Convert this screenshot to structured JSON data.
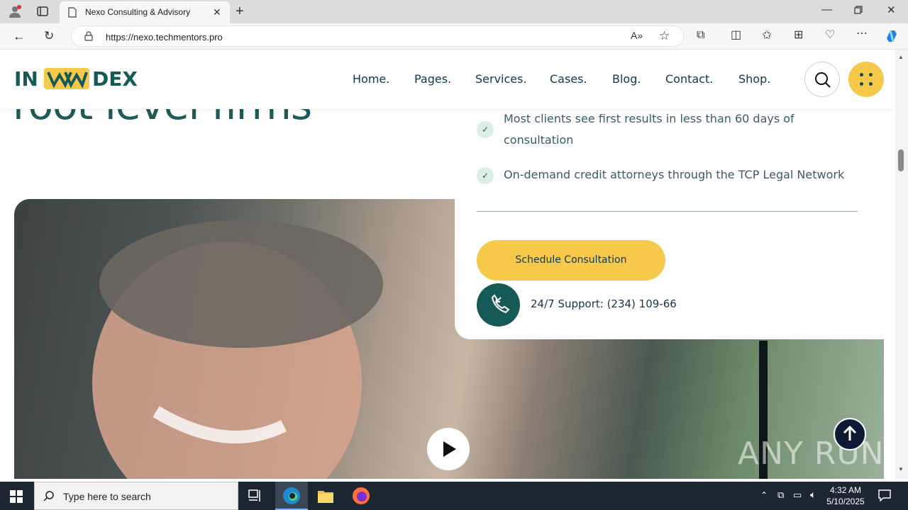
{
  "browser": {
    "tab_title": "Nexo Consulting & Advisory",
    "url": "https://nexo.techmentors.pro"
  },
  "site": {
    "logo_left": "IN",
    "logo_right": "DEX",
    "nav": [
      "Home.",
      "Pages.",
      "Services.",
      "Cases.",
      "Blog.",
      "Contact.",
      "Shop."
    ],
    "heading_partial": "root level firms",
    "features": [
      "Most clients see first results in less than 60 days of consultation",
      "On-demand credit attorneys through the TCP Legal Network"
    ],
    "cta_label": "Schedule Consultation",
    "support_text": "24/7 Support: (234) 109-66",
    "watermark": "ANY RUN",
    "colors": {
      "brand_green": "#165a57",
      "accent_yellow": "#f7c94b",
      "nav_text": "#12374a"
    }
  },
  "taskbar": {
    "search_placeholder": "Type here to search",
    "time": "4:32 AM",
    "date": "5/10/2025"
  }
}
